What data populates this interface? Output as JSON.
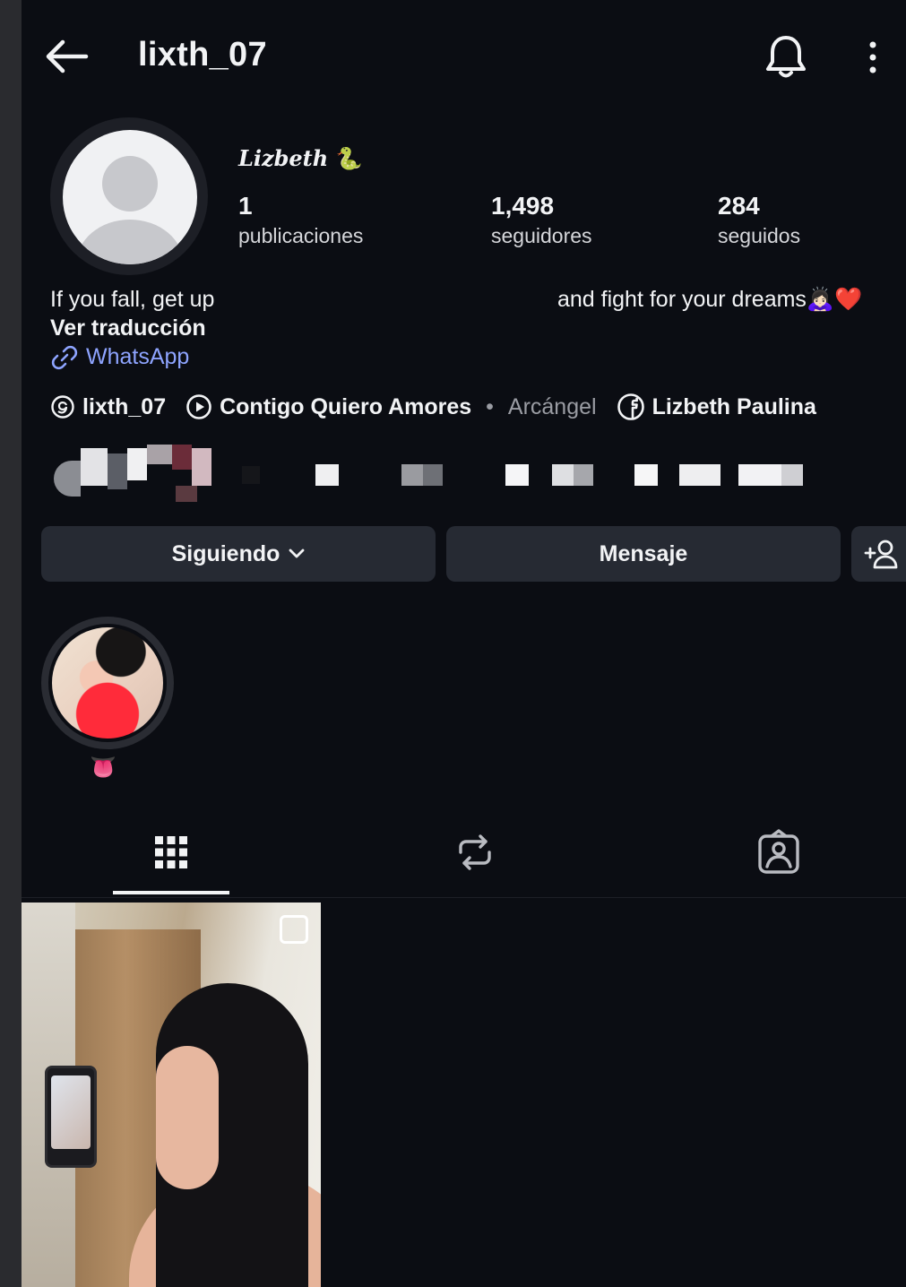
{
  "header": {
    "username": "lixth_07"
  },
  "profile": {
    "display_name": "Lizbeth",
    "display_name_emoji": "🐍",
    "stats": [
      {
        "value": "1",
        "label": "publicaciones"
      },
      {
        "value": "1,498",
        "label": "seguidores"
      },
      {
        "value": "284",
        "label": "seguidos"
      }
    ],
    "bio_line_1": "If you fall, get up",
    "bio_line_2": "and fight for your dreams",
    "bio_line_2_emoji": "🙇🏻‍♀️❤️",
    "translate_label": "Ver traducción",
    "link_label": "WhatsApp"
  },
  "chips": {
    "threads": "lixth_07",
    "song_title": "Contigo Quiero Amores",
    "separator": "•",
    "song_artist": "Arcángel",
    "facebook": "Lizbeth Paulina"
  },
  "actions": {
    "following_label": "Siguiendo",
    "message_label": "Mensaje"
  },
  "highlights": [
    {
      "label": "👅"
    }
  ],
  "tabs": [
    {
      "icon": "grid-icon",
      "active": true
    },
    {
      "icon": "reposts-icon",
      "active": false
    },
    {
      "icon": "tagged-icon",
      "active": false
    }
  ],
  "colors": {
    "background": "#0b0d13",
    "button": "#262a33",
    "link": "#8ea4ff"
  }
}
